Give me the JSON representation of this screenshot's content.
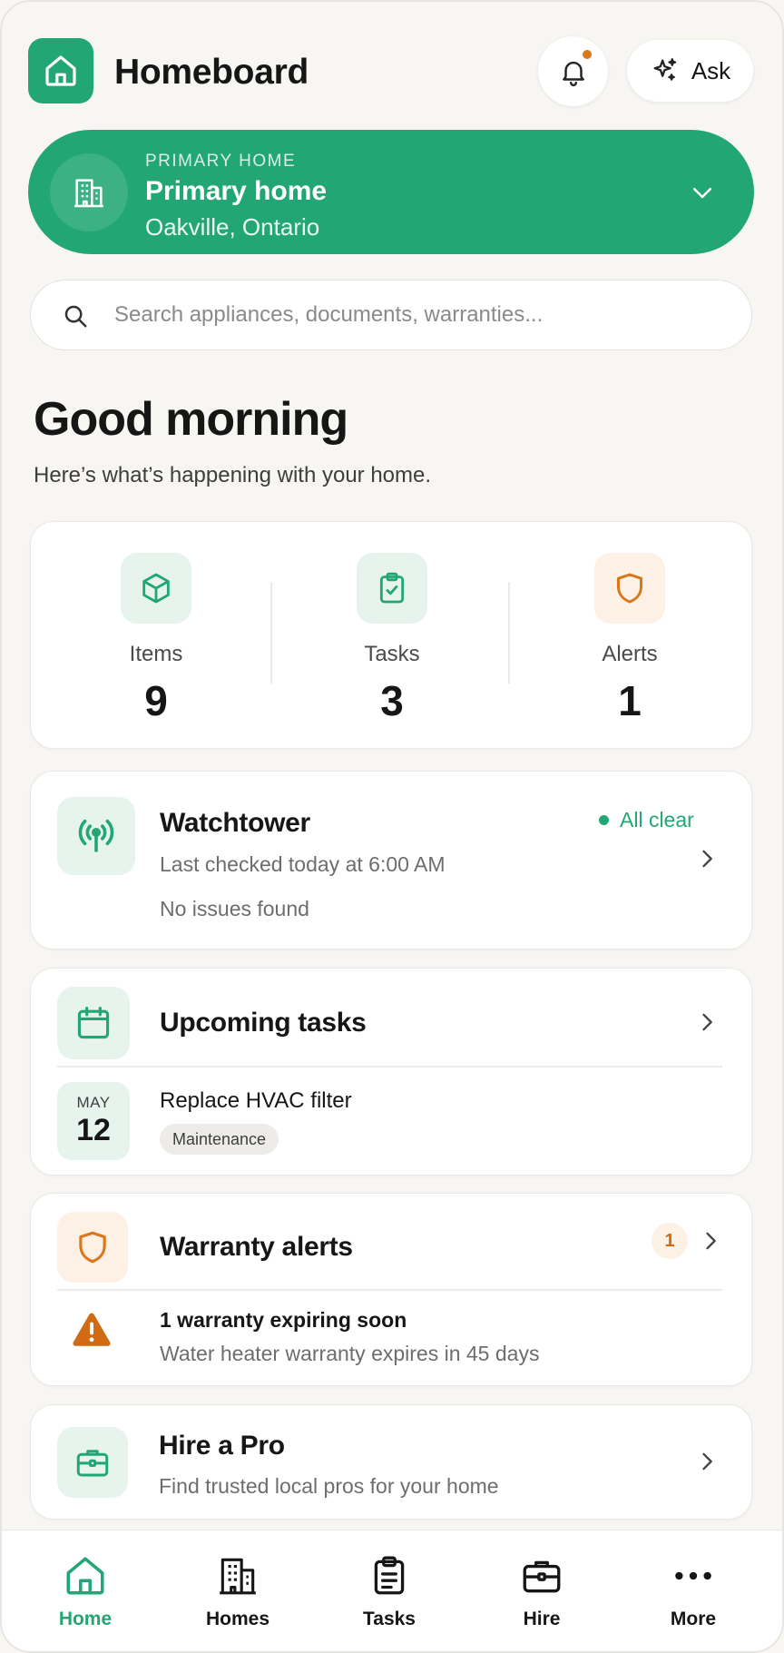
{
  "app": {
    "title": "Homeboard"
  },
  "header": {
    "ask_label": "Ask",
    "notifications_unread": true
  },
  "home_selector": {
    "eyebrow": "PRIMARY HOME",
    "name": "Primary home",
    "location": "Oakville, Ontario"
  },
  "search": {
    "placeholder": "Search appliances, documents, warranties..."
  },
  "greeting": {
    "title": "Good morning",
    "subtitle": "Here’s what’s happening with your home."
  },
  "stats": [
    {
      "label": "Items",
      "value": "9",
      "icon": "box-icon"
    },
    {
      "label": "Tasks",
      "value": "3",
      "icon": "clipboard-check-icon"
    },
    {
      "label": "Alerts",
      "value": "1",
      "icon": "shield-icon"
    }
  ],
  "watchtower": {
    "title": "Watchtower",
    "status": "All clear",
    "last_checked": "Last checked today at 6:00 AM",
    "detail": "No issues found"
  },
  "upcoming_tasks": {
    "title": "Upcoming tasks",
    "items": [
      {
        "month": "MAY",
        "day": "12",
        "name": "Replace HVAC filter",
        "tag": "Maintenance"
      }
    ]
  },
  "warranty_alerts": {
    "title": "Warranty alerts",
    "count": "1",
    "headline": "1 warranty expiring soon",
    "detail": "Water heater warranty expires in 45 days"
  },
  "hire_pro": {
    "title": "Hire a Pro",
    "subtitle": "Find trusted local pros for your home"
  },
  "bottom_nav": [
    {
      "label": "Home",
      "active": true
    },
    {
      "label": "Homes",
      "active": false
    },
    {
      "label": "Tasks",
      "active": false
    },
    {
      "label": "Hire",
      "active": false
    },
    {
      "label": "More",
      "active": false
    }
  ],
  "colors": {
    "brand_green": "#22a774",
    "accent_orange": "#d9771b",
    "background": "#f7f6f3"
  }
}
